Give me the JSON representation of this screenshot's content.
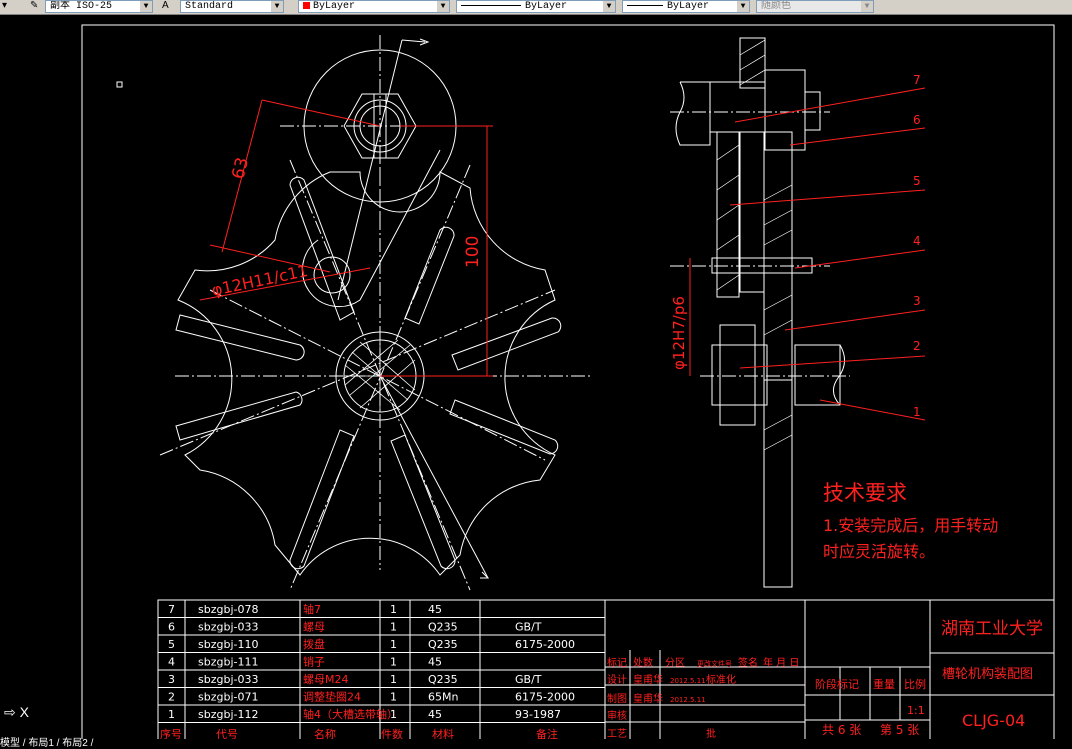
{
  "toolbar": {
    "dimstyle_label": "副本 ISO-25",
    "textstyle_label": "Standard",
    "layer_color": "ByLayer",
    "linetype": "ByLayer",
    "lineweight": "ByLayer",
    "plotstyle": "随颜色",
    "accent_red": "#ff0000"
  },
  "dims": {
    "d63": "63",
    "d100": "100",
    "fit1": "φ12H11/c11",
    "fit2": "φ12H7/p6"
  },
  "callouts": [
    "7",
    "6",
    "5",
    "4",
    "3",
    "2",
    "1"
  ],
  "tech": {
    "title": "技术要求",
    "line1": "1.安装完成后，用手转动",
    "line2": "时应灵活旋转。"
  },
  "bom": {
    "rows": [
      {
        "no": "7",
        "code": "sbzgbj-078",
        "name": "轴7",
        "qty": "1",
        "mat": "45",
        "note": ""
      },
      {
        "no": "6",
        "code": "sbzgbj-033",
        "name": "螺母",
        "qty": "1",
        "mat": "Q235",
        "note": "GB/T"
      },
      {
        "no": "5",
        "code": "sbzgbj-110",
        "name": "拨盘",
        "qty": "1",
        "mat": "Q235",
        "note": "6175-2000"
      },
      {
        "no": "4",
        "code": "sbzgbj-111",
        "name": "销子",
        "qty": "1",
        "mat": "45",
        "note": ""
      },
      {
        "no": "3",
        "code": "sbzgbj-033",
        "name": "螺母M24",
        "qty": "1",
        "mat": "Q235",
        "note": "GB/T"
      },
      {
        "no": "2",
        "code": "sbzgbj-071",
        "name": "调整垫圈24",
        "qty": "1",
        "mat": "65Mn",
        "note": "6175-2000"
      },
      {
        "no": "1",
        "code": "sbzgbj-112",
        "name": "轴4（大槽选带轴）",
        "qty": "1",
        "mat": "45",
        "note": "93-1987"
      }
    ],
    "headers": {
      "no": "序号",
      "code": "代号",
      "name": "名称",
      "qty": "件数",
      "mat": "材料",
      "note": "备注"
    }
  },
  "title_block": {
    "university": "湖南工业大学",
    "drawing_name": "槽轮机构装配图",
    "drawing_code": "CLJG-04",
    "scale_value": "1:1",
    "stage": "阶段标记",
    "weight": "重量",
    "scale": "比例",
    "sheets": "共 6  张",
    "sheet_no": "第 5  张",
    "mark": "标记",
    "count": "处数",
    "zone": "分区",
    "doc": "更改文件号",
    "sign": "签名",
    "ymd": "年  月  日",
    "design": "设计",
    "designer": "皇甫华",
    "date1": "2012.5.11",
    "std": "标准化",
    "draw": "制图",
    "drawer": "皇甫华",
    "date2": "2012.5.11",
    "check": "审核",
    "process": "工艺",
    "approve": "批"
  },
  "tabs": "模型 / 布局1 / 布局2 /",
  "ucs": "X"
}
